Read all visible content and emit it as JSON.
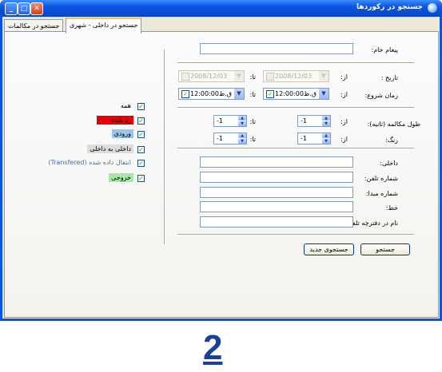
{
  "window": {
    "title": "جستجو در رکوردها",
    "minimize_glyph": "_",
    "maximize_glyph": "□",
    "close_glyph": "✕"
  },
  "tabs": [
    {
      "label": "جستجو در داخلی - شهری",
      "active": true
    },
    {
      "label": "جستجو در مکالمات",
      "active": false
    }
  ],
  "form": {
    "raw_message_label": "پیغام خام:",
    "date_label": "تاریخ :",
    "from_label": "از:",
    "to_label": "تا:",
    "date_from_value": "2008/12/03",
    "date_to_value": "2008/12/03",
    "start_time_label": "زمان شروع:",
    "time_from_value": "12:00:00",
    "time_from_ampm": "ق.ظ",
    "time_to_value": "12:00:00",
    "time_to_ampm": "ق.ظ",
    "duration_label": "طول مکالمه (ثانیه):",
    "duration_from": "-1",
    "duration_to": "-1",
    "ring_label": "زنگ:",
    "ring_from": "-1",
    "ring_to": "-1",
    "internal_label": "داخلی:",
    "phone_number_label": "شماره تلفن:",
    "source_number_label": "شماره مبدا:",
    "line_label": "خط:",
    "phonebook_name_label": "نام در دفترچه تلفن:"
  },
  "checkboxes": {
    "check_glyph": "✓",
    "items": [
      {
        "label": "همه",
        "color": ""
      },
      {
        "label": "رد شده",
        "color": "#e80000"
      },
      {
        "label": "ورودی",
        "color": "#9bc5e8"
      },
      {
        "label": "داخلی به داخلی",
        "color": "#dcdcdc"
      },
      {
        "label": "انتقال داده شده (Transfered)",
        "color": ""
      },
      {
        "label": "خروجی",
        "color": "#a6e8a6"
      }
    ]
  },
  "buttons": {
    "search": "جستجو",
    "new_search": "جستجوی جدید"
  },
  "footer_number": "2",
  "icons": {
    "combo_drop": "▼",
    "spin_up": "▲",
    "spin_down": "▼"
  }
}
